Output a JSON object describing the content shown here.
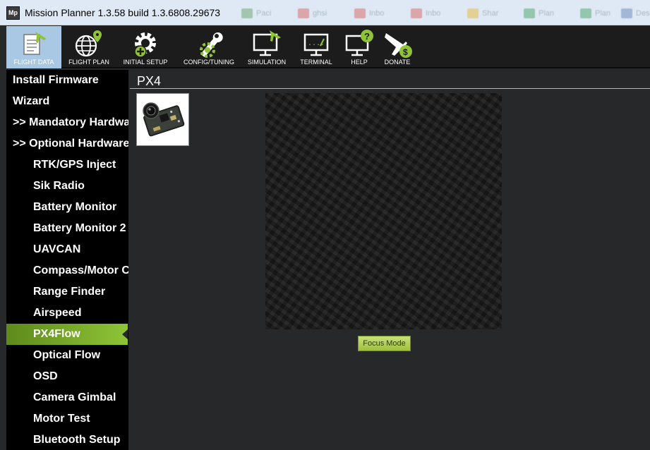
{
  "window": {
    "logo_text": "Mp",
    "title": "Mission Planner 1.3.58 build 1.3.6808.29673"
  },
  "background_tabs": [
    "Paci",
    "ghsi",
    "Inbo",
    "Inbo",
    "Shar",
    "Plan",
    "Plan",
    "Desi"
  ],
  "toolbar": {
    "items": [
      {
        "label": "FLIGHT DATA",
        "icon": "flight-data-icon",
        "active": true
      },
      {
        "label": "FLIGHT PLAN",
        "icon": "flight-plan-icon"
      },
      {
        "label": "INITIAL SETUP",
        "icon": "initial-setup-icon"
      },
      {
        "label": "CONFIG/TUNING",
        "icon": "config-tuning-icon"
      },
      {
        "label": "SIMULATION",
        "icon": "simulation-icon"
      },
      {
        "label": "TERMINAL",
        "icon": "terminal-icon"
      },
      {
        "label": "HELP",
        "icon": "help-icon"
      },
      {
        "label": "DONATE",
        "icon": "donate-icon"
      }
    ]
  },
  "sidebar": {
    "items": [
      {
        "label": "Install Firmware",
        "level": "top"
      },
      {
        "label": "Wizard",
        "level": "top"
      },
      {
        "label": ">> Mandatory Hardware",
        "level": "top"
      },
      {
        "label": ">> Optional Hardware",
        "level": "top"
      },
      {
        "label": "RTK/GPS Inject",
        "level": "sub"
      },
      {
        "label": "Sik Radio",
        "level": "sub"
      },
      {
        "label": "Battery Monitor",
        "level": "sub"
      },
      {
        "label": "Battery Monitor 2",
        "level": "sub"
      },
      {
        "label": "UAVCAN",
        "level": "sub"
      },
      {
        "label": "Compass/Motor Calib",
        "level": "sub"
      },
      {
        "label": "Range Finder",
        "level": "sub"
      },
      {
        "label": "Airspeed",
        "level": "sub"
      },
      {
        "label": "PX4Flow",
        "level": "sub",
        "selected": true
      },
      {
        "label": "Optical Flow",
        "level": "sub"
      },
      {
        "label": "OSD",
        "level": "sub"
      },
      {
        "label": "Camera Gimbal",
        "level": "sub"
      },
      {
        "label": "Motor Test",
        "level": "sub"
      },
      {
        "label": "Bluetooth Setup",
        "level": "sub"
      }
    ]
  },
  "main": {
    "title": "PX4",
    "focus_button_label": "Focus Mode"
  },
  "colors": {
    "accent_green": "#8fc437",
    "active_toolbar": "#a9c8e3",
    "sidebar_bg": "#000000",
    "main_bg": "#26282a"
  }
}
